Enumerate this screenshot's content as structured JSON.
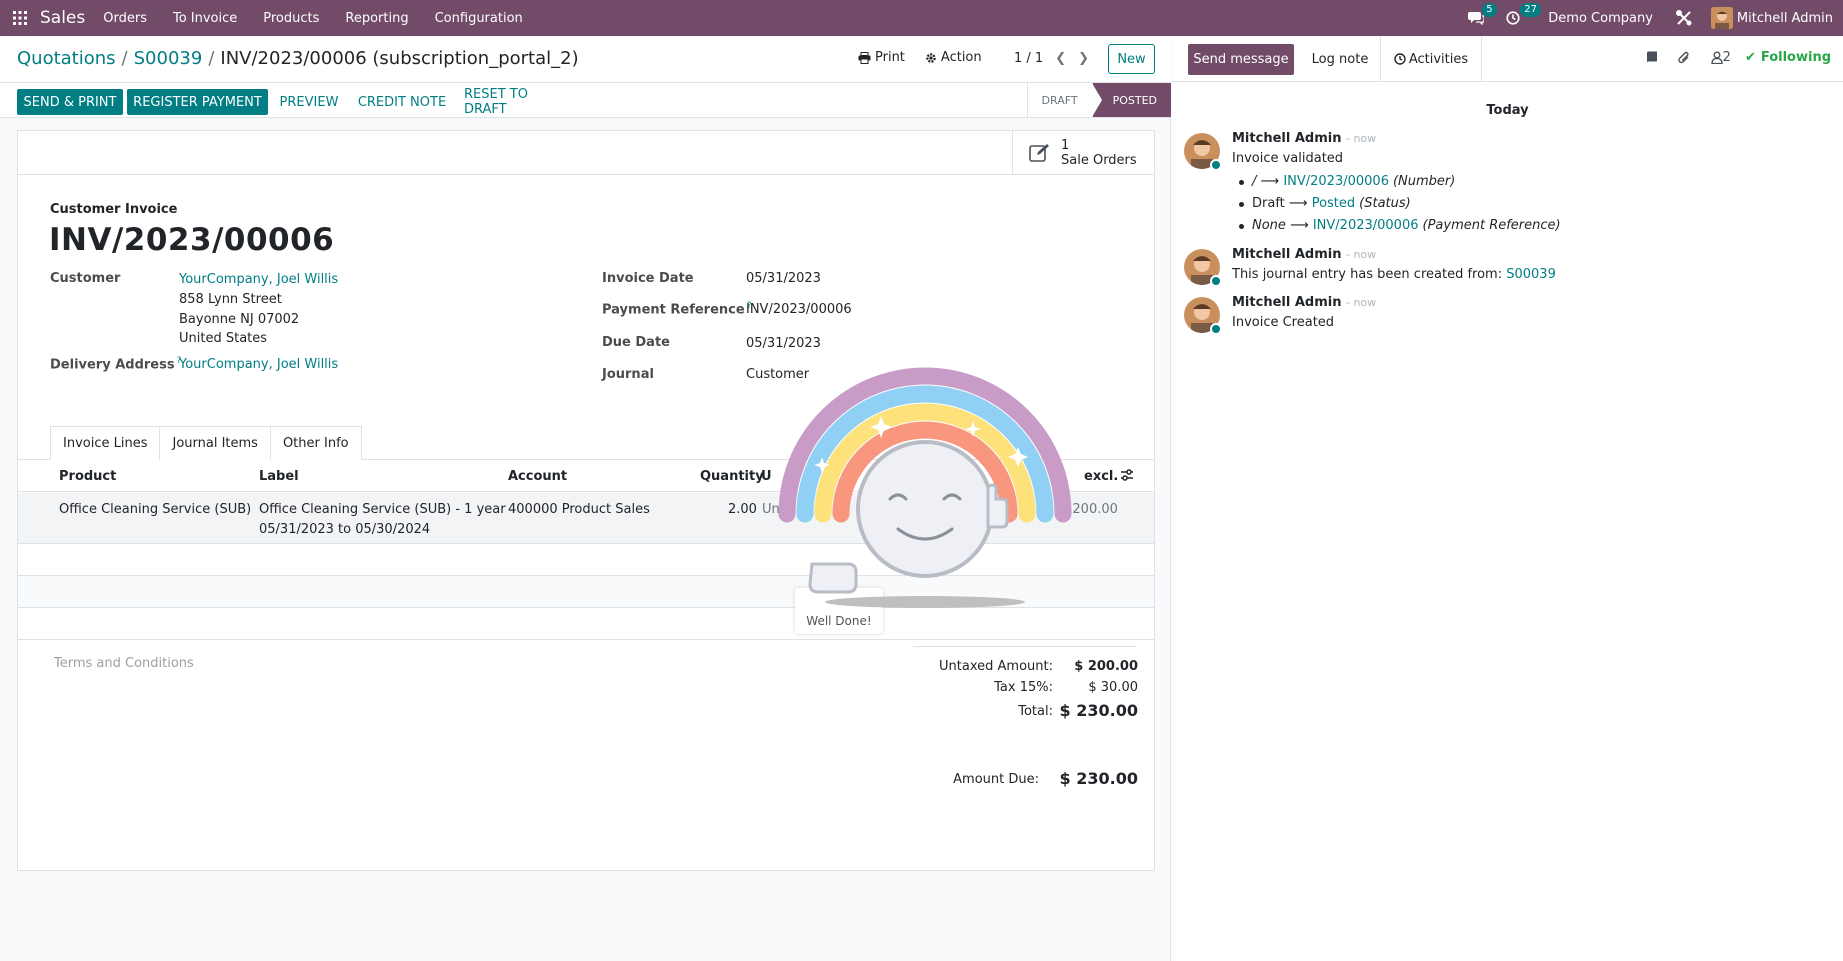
{
  "navbar": {
    "app_name": "Sales",
    "menu": [
      "Orders",
      "To Invoice",
      "Products",
      "Reporting",
      "Configuration"
    ],
    "messages_count": "5",
    "activities_count": "27",
    "company": "Demo Company",
    "user": "Mitchell Admin"
  },
  "breadcrumb": {
    "root": "Quotations",
    "order": "S00039",
    "current": "INV/2023/00006 (subscription_portal_2)"
  },
  "control": {
    "print_label": "Print",
    "action_label": "Action",
    "pager": "1 / 1",
    "new_label": "New"
  },
  "statusbar": {
    "send_print": "SEND & PRINT",
    "register_payment": "REGISTER PAYMENT",
    "preview": "PREVIEW",
    "credit_note": "CREDIT NOTE",
    "reset_to_draft": "RESET TO DRAFT",
    "states": [
      "DRAFT",
      "POSTED"
    ],
    "active_state": "POSTED"
  },
  "smart_button": {
    "count": "1",
    "label": "Sale Orders"
  },
  "invoice": {
    "type": "Customer Invoice",
    "number": "INV/2023/00006",
    "customer_label": "Customer",
    "customer": "YourCompany, Joel Willis",
    "address": [
      "858 Lynn Street",
      "Bayonne NJ 07002",
      "United States"
    ],
    "delivery_label": "Delivery Address",
    "delivery": "YourCompany, Joel Willis",
    "invoice_date_label": "Invoice Date",
    "invoice_date": "05/31/2023",
    "payment_ref_label": "Payment Reference",
    "payment_ref": "INV/2023/00006",
    "due_date_label": "Due Date",
    "due_date": "05/31/2023",
    "journal_label": "Journal",
    "journal": "Customer"
  },
  "tabs": [
    "Invoice Lines",
    "Journal Items",
    "Other Info"
  ],
  "lines": {
    "headers": {
      "product": "Product",
      "label": "Label",
      "account": "Account",
      "quantity": "Quantity",
      "uom": "U",
      "subtotal": "excl."
    },
    "rows": [
      {
        "product": "Office Cleaning Service (SUB)",
        "label_1": "Office Cleaning Service (SUB) - 1 year",
        "label_2": "05/31/2023 to 05/30/2024",
        "account": "400000 Product Sales",
        "quantity": "2.00",
        "uom": "Units",
        "subtotal": "$ 200.00"
      }
    ]
  },
  "terms_placeholder": "Terms and Conditions",
  "totals": {
    "untaxed_label": "Untaxed Amount:",
    "untaxed": "$ 200.00",
    "tax_label": "Tax 15%:",
    "tax": "$ 30.00",
    "total_label": "Total:",
    "total": "$ 230.00",
    "due_label": "Amount Due:",
    "due": "$ 230.00"
  },
  "celebration": {
    "text": "Well Done!"
  },
  "chatter": {
    "send_message": "Send message",
    "log_note": "Log note",
    "activities": "Activities",
    "followers": "2",
    "following": "Following",
    "day": "Today",
    "messages": [
      {
        "author": "Mitchell Admin",
        "time": "- now",
        "body": "Invoice validated",
        "tracking": [
          {
            "old": "/",
            "new": "INV/2023/00006",
            "field": "(Number)"
          },
          {
            "old": "Draft",
            "new": "Posted",
            "field": "(Status)"
          },
          {
            "old": "None",
            "new": "INV/2023/00006",
            "field": "(Payment Reference)"
          }
        ]
      },
      {
        "author": "Mitchell Admin",
        "time": "- now",
        "body": "This journal entry has been created from:",
        "link": "S00039"
      },
      {
        "author": "Mitchell Admin",
        "time": "- now",
        "body": "Invoice Created"
      }
    ]
  },
  "colors": {
    "brand": "#714b67",
    "accent": "#017e84"
  }
}
